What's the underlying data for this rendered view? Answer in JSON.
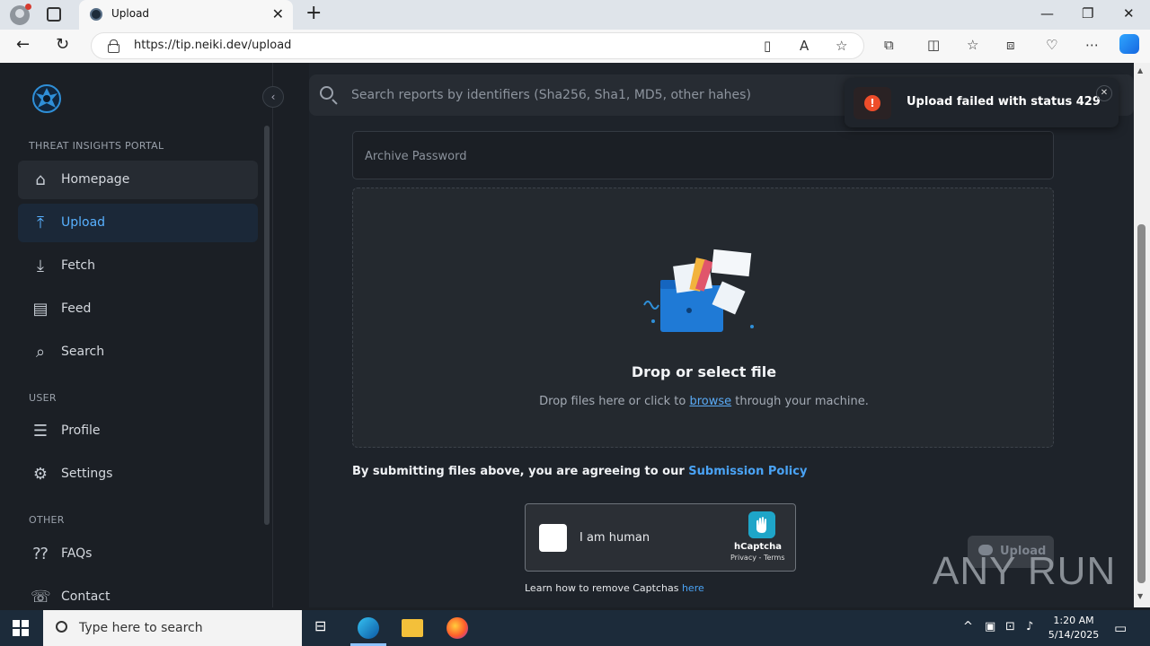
{
  "browser": {
    "tab_title": "Upload",
    "url": "https://tip.neiki.dev/upload"
  },
  "sidebar": {
    "sections": [
      {
        "label": "THREAT INSIGHTS PORTAL"
      },
      {
        "label": "USER"
      },
      {
        "label": "OTHER"
      }
    ],
    "items": [
      {
        "label": "Homepage",
        "icon": "home-icon"
      },
      {
        "label": "Upload",
        "icon": "upload-icon"
      },
      {
        "label": "Fetch",
        "icon": "download-icon"
      },
      {
        "label": "Feed",
        "icon": "feed-icon"
      },
      {
        "label": "Search",
        "icon": "search-icon"
      },
      {
        "label": "Profile",
        "icon": "profile-icon"
      },
      {
        "label": "Settings",
        "icon": "gear-icon"
      },
      {
        "label": "FAQs",
        "icon": "faq-icon"
      },
      {
        "label": "Contact",
        "icon": "contact-icon"
      }
    ]
  },
  "search": {
    "placeholder": "Search reports by identifiers (Sha256, Sha1, MD5, other hahes)"
  },
  "form": {
    "password_placeholder": "Archive Password",
    "drop_title": "Drop or select file",
    "drop_sub_before": "Drop files here or click to ",
    "drop_sub_link": "browse",
    "drop_sub_after": " through your machine.",
    "agree_text": "By submitting files above, you are agreeing to our ",
    "agree_link": "Submission Policy",
    "captcha_label": "I am human",
    "captcha_brand": "hCaptcha",
    "captcha_terms": "Privacy - Terms",
    "learn_text": "Learn how to remove Captchas ",
    "learn_link": "here",
    "upload_label": "Upload"
  },
  "toast": {
    "message": "Upload failed with status 429"
  },
  "watermark": "ANY RUN",
  "taskbar": {
    "search_placeholder": "Type here to search",
    "time": "1:20 AM",
    "date": "5/14/2025"
  },
  "colors": {
    "accent": "#58b1ff",
    "error": "#ee4d2a",
    "background": "#1b1f25"
  }
}
